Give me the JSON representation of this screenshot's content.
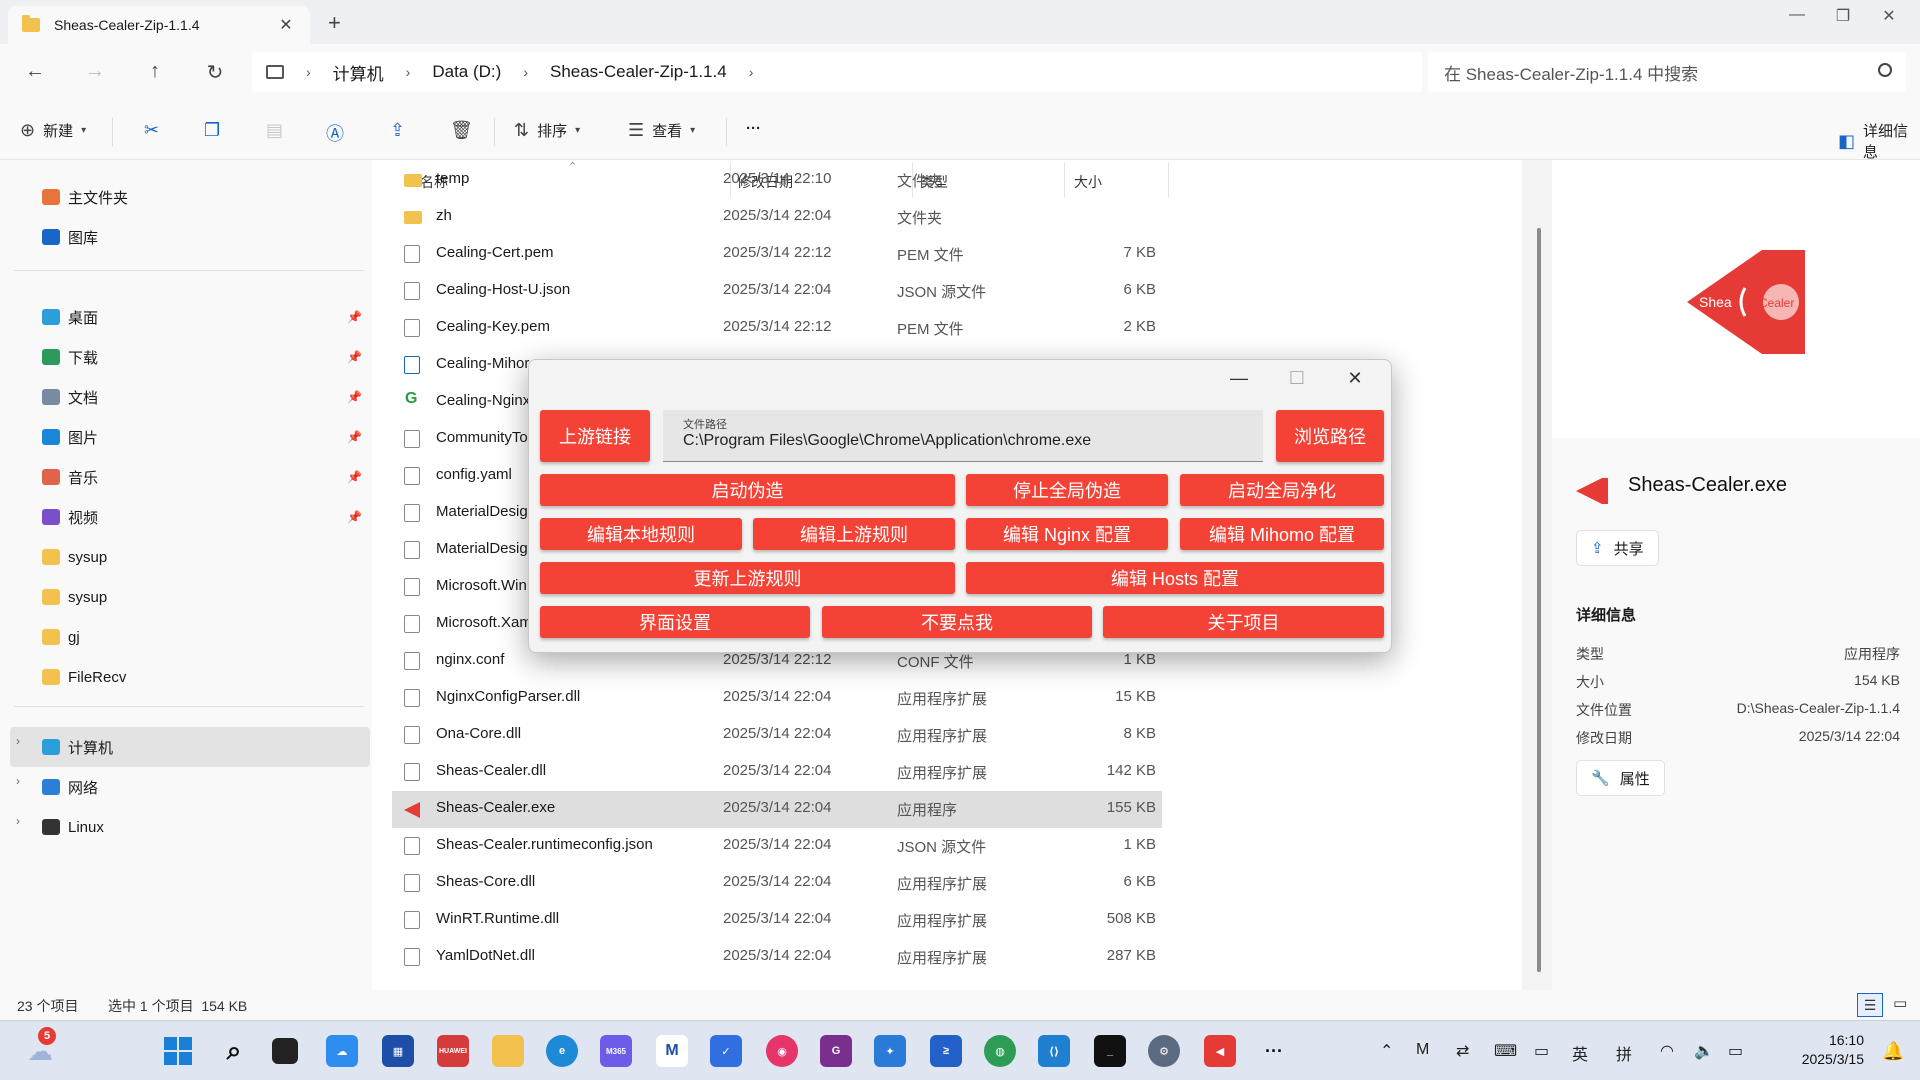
{
  "window": {
    "tab_title": "Sheas-Cealer-Zip-1.1.4",
    "tab_close": "✕",
    "tab_add": "+",
    "minimize": "—",
    "restore": "❐",
    "close": "✕"
  },
  "nav": {
    "back": "←",
    "forward": "→",
    "up": "↑",
    "refresh": "↻",
    "breadcrumb": [
      "计算机",
      "Data (D:)",
      "Sheas-Cealer-Zip-1.1.4"
    ],
    "search_placeholder": "在 Sheas-Cealer-Zip-1.1.4 中搜索"
  },
  "toolbar": {
    "new_label": "新建",
    "sort_label": "排序",
    "view_label": "查看",
    "more": "···",
    "details_label": "详细信息"
  },
  "sidebar": {
    "quick": [
      {
        "label": "主文件夹",
        "icon": "home-icon",
        "color": "#e8743b"
      },
      {
        "label": "图库",
        "icon": "gallery-icon",
        "color": "#1a66c8"
      }
    ],
    "pinned": [
      {
        "label": "桌面",
        "icon": "desktop-icon",
        "color": "#2b9fd9"
      },
      {
        "label": "下载",
        "icon": "download-icon",
        "color": "#2b9a5a"
      },
      {
        "label": "文档",
        "icon": "documents-icon",
        "color": "#7a8aa0"
      },
      {
        "label": "图片",
        "icon": "pictures-icon",
        "color": "#1a86d8"
      },
      {
        "label": "音乐",
        "icon": "music-icon",
        "color": "#e0644a"
      },
      {
        "label": "视频",
        "icon": "video-icon",
        "color": "#7b4fc9"
      },
      {
        "label": "sysup",
        "icon": "folder-icon",
        "color": "#f2c14e"
      },
      {
        "label": "sysup",
        "icon": "folder-icon",
        "color": "#f2c14e"
      },
      {
        "label": "gj",
        "icon": "folder-icon",
        "color": "#f2c14e"
      },
      {
        "label": "FileRecv",
        "icon": "folder-icon",
        "color": "#f2c14e"
      }
    ],
    "locations": [
      {
        "label": "计算机",
        "icon": "computer-icon",
        "color": "#2b9fd9"
      },
      {
        "label": "网络",
        "icon": "network-icon",
        "color": "#2b7fd9"
      },
      {
        "label": "Linux",
        "icon": "linux-icon",
        "color": "#333333"
      }
    ]
  },
  "columns": {
    "name": "名称",
    "date": "修改日期",
    "type": "类型",
    "size": "大小"
  },
  "files": [
    {
      "name": "temp",
      "date": "2025/3/14 22:10",
      "type": "文件夹",
      "size": "",
      "icon": "folder"
    },
    {
      "name": "zh",
      "date": "2025/3/14 22:04",
      "type": "文件夹",
      "size": "",
      "icon": "folder"
    },
    {
      "name": "Cealing-Cert.pem",
      "date": "2025/3/14 22:12",
      "type": "PEM 文件",
      "size": "7 KB",
      "icon": "file"
    },
    {
      "name": "Cealing-Host-U.json",
      "date": "2025/3/14 22:04",
      "type": "JSON 源文件",
      "size": "6 KB",
      "icon": "file"
    },
    {
      "name": "Cealing-Key.pem",
      "date": "2025/3/14 22:12",
      "type": "PEM 文件",
      "size": "2 KB",
      "icon": "file"
    },
    {
      "name": "Cealing-Mihor",
      "date": "",
      "type": "",
      "size": "",
      "icon": "blue"
    },
    {
      "name": "Cealing-Nginx",
      "date": "",
      "type": "",
      "size": "",
      "icon": "g"
    },
    {
      "name": "CommunityTo",
      "date": "",
      "type": "",
      "size": "",
      "icon": "file"
    },
    {
      "name": "config.yaml",
      "date": "",
      "type": "",
      "size": "",
      "icon": "file"
    },
    {
      "name": "MaterialDesig",
      "date": "",
      "type": "",
      "size": "",
      "icon": "file"
    },
    {
      "name": "MaterialDesig",
      "date": "",
      "type": "",
      "size": "",
      "icon": "file"
    },
    {
      "name": "Microsoft.Win",
      "date": "",
      "type": "",
      "size": "",
      "icon": "file"
    },
    {
      "name": "Microsoft.Xam",
      "date": "",
      "type": "",
      "size": "",
      "icon": "file"
    },
    {
      "name": "nginx.conf",
      "date": "2025/3/14 22:12",
      "type": "CONF 文件",
      "size": "1 KB",
      "icon": "file"
    },
    {
      "name": "NginxConfigParser.dll",
      "date": "2025/3/14 22:04",
      "type": "应用程序扩展",
      "size": "15 KB",
      "icon": "file"
    },
    {
      "name": "Ona-Core.dll",
      "date": "2025/3/14 22:04",
      "type": "应用程序扩展",
      "size": "8 KB",
      "icon": "file"
    },
    {
      "name": "Sheas-Cealer.dll",
      "date": "2025/3/14 22:04",
      "type": "应用程序扩展",
      "size": "142 KB",
      "icon": "file"
    },
    {
      "name": "Sheas-Cealer.exe",
      "date": "2025/3/14 22:04",
      "type": "应用程序",
      "size": "155 KB",
      "icon": "exe",
      "selected": true
    },
    {
      "name": "Sheas-Cealer.runtimeconfig.json",
      "date": "2025/3/14 22:04",
      "type": "JSON 源文件",
      "size": "1 KB",
      "icon": "file"
    },
    {
      "name": "Sheas-Core.dll",
      "date": "2025/3/14 22:04",
      "type": "应用程序扩展",
      "size": "6 KB",
      "icon": "file"
    },
    {
      "name": "WinRT.Runtime.dll",
      "date": "2025/3/14 22:04",
      "type": "应用程序扩展",
      "size": "508 KB",
      "icon": "file"
    },
    {
      "name": "YamlDotNet.dll",
      "date": "2025/3/14 22:04",
      "type": "应用程序扩展",
      "size": "287 KB",
      "icon": "file"
    }
  ],
  "details": {
    "logo_left": "Shea",
    "logo_right": "Cealer",
    "title": "Sheas-Cealer.exe",
    "share_label": "共享",
    "section_label": "详细信息",
    "rows": [
      {
        "k": "类型",
        "v": "应用程序"
      },
      {
        "k": "大小",
        "v": "154 KB"
      },
      {
        "k": "文件位置",
        "v": "D:\\Sheas-Cealer-Zip-1.1.4"
      },
      {
        "k": "修改日期",
        "v": "2025/3/14 22:04"
      }
    ],
    "properties_label": "属性"
  },
  "status": {
    "count": "23 个项目",
    "selection": "选中 1 个项目  154 KB"
  },
  "dialog": {
    "minimize": "—",
    "maximize": "☐",
    "close": "✕",
    "upstream_link": "上游链接",
    "path_label": "文件路径",
    "path_value": "C:\\Program Files\\Google\\Chrome\\Application\\chrome.exe",
    "browse": "浏览路径",
    "start_spoof": "启动伪造",
    "stop_global": "停止全局伪造",
    "start_global_clean": "启动全局净化",
    "edit_local": "编辑本地规则",
    "edit_upstream": "编辑上游规则",
    "edit_nginx": "编辑 Nginx 配置",
    "edit_mihomo": "编辑 Mihomo 配置",
    "update_upstream": "更新上游规则",
    "edit_hosts": "编辑 Hosts 配置",
    "ui_settings": "界面设置",
    "dont_click": "不要点我",
    "about": "关于项目",
    "accent": "#f44336"
  },
  "taskbar": {
    "weather_badge": "5",
    "huawei": "HUAWEI",
    "m365": "M365",
    "tray_lang": "英",
    "tray_ime": "拼",
    "time": "16:10",
    "date": "2025/3/15"
  }
}
